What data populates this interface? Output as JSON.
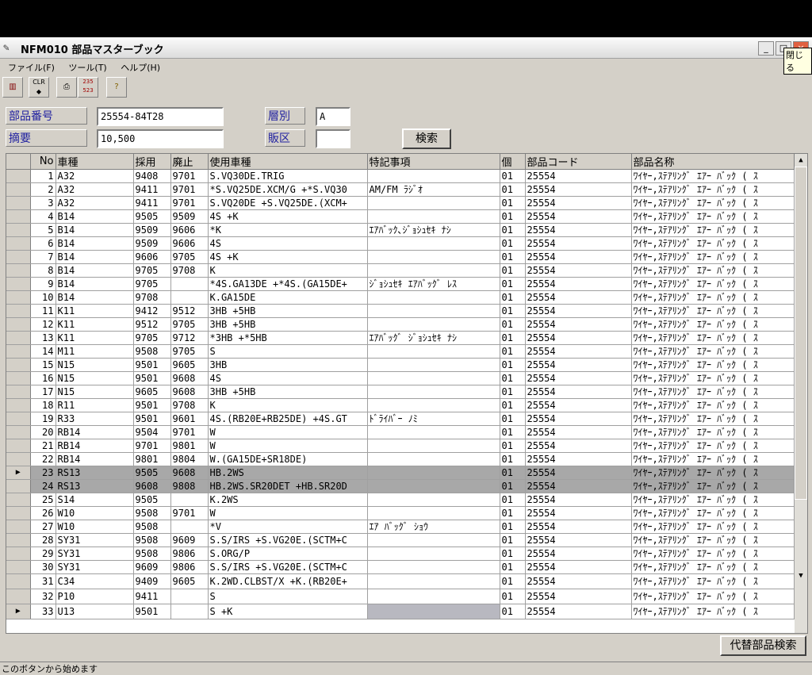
{
  "window": {
    "title": "NFM010 部品マスターブック",
    "tooltip": "閉じる",
    "min": "_",
    "max": "□",
    "close": "×"
  },
  "menu": [
    "ファイル(F)",
    "ツール(T)",
    "ヘルプ(H)"
  ],
  "toolbar": {
    "clr_label": "CLR",
    "num_label": "235 523"
  },
  "form": {
    "part_no_label": "部品番号",
    "part_no_value": "25554-84T28",
    "summary_label": "摘要",
    "summary_value": "10,500",
    "layer_label": "層別",
    "layer_value": "A",
    "sales_label": "販区",
    "sales_value": "",
    "search_button": "検索"
  },
  "table": {
    "headers": [
      "No",
      "車種",
      "採用",
      "廃止",
      "使用車種",
      "特記事項",
      "個",
      "部品コード",
      "部品名称"
    ],
    "rows": [
      [
        "1",
        "A32",
        "9408",
        "9701",
        "S.VQ30DE.TRIG",
        "",
        "01",
        "25554",
        "ﾜｲﾔｰ,ｽﾃｱﾘﾝｸﾞ ｴｱｰ ﾊﾞｯｸ ( ｽ"
      ],
      [
        "2",
        "A32",
        "9411",
        "9701",
        "*S.VQ25DE.XCM/G +*S.VQ30",
        "AM/FM ﾗｼﾞｵ",
        "01",
        "25554",
        "ﾜｲﾔｰ,ｽﾃｱﾘﾝｸﾞ ｴｱｰ ﾊﾞｯｸ ( ｽ"
      ],
      [
        "3",
        "A32",
        "9411",
        "9701",
        "S.VQ20DE +S.VQ25DE.(XCM+",
        "",
        "01",
        "25554",
        "ﾜｲﾔｰ,ｽﾃｱﾘﾝｸﾞ ｴｱｰ ﾊﾞｯｸ ( ｽ"
      ],
      [
        "4",
        "B14",
        "9505",
        "9509",
        "4S +K",
        "",
        "01",
        "25554",
        "ﾜｲﾔｰ,ｽﾃｱﾘﾝｸﾞ ｴｱｰ ﾊﾞｯｸ ( ｽ"
      ],
      [
        "5",
        "B14",
        "9509",
        "9606",
        "*K",
        "ｴｱﾊﾞｯｸ､ｼﾞｮｼｭｾｷ ﾅｼ",
        "01",
        "25554",
        "ﾜｲﾔｰ,ｽﾃｱﾘﾝｸﾞ ｴｱｰ ﾊﾞｯｸ ( ｽ"
      ],
      [
        "6",
        "B14",
        "9509",
        "9606",
        "4S",
        "",
        "01",
        "25554",
        "ﾜｲﾔｰ,ｽﾃｱﾘﾝｸﾞ ｴｱｰ ﾊﾞｯｸ ( ｽ"
      ],
      [
        "7",
        "B14",
        "9606",
        "9705",
        "4S +K",
        "",
        "01",
        "25554",
        "ﾜｲﾔｰ,ｽﾃｱﾘﾝｸﾞ ｴｱｰ ﾊﾞｯｸ ( ｽ"
      ],
      [
        "8",
        "B14",
        "9705",
        "9708",
        "K",
        "",
        "01",
        "25554",
        "ﾜｲﾔｰ,ｽﾃｱﾘﾝｸﾞ ｴｱｰ ﾊﾞｯｸ ( ｽ"
      ],
      [
        "9",
        "B14",
        "9705",
        "",
        "*4S.GA13DE +*4S.(GA15DE+",
        "ｼﾞｮｼｭｾｷ ｴｱﾊﾞｯｸﾞ ﾚｽ",
        "01",
        "25554",
        "ﾜｲﾔｰ,ｽﾃｱﾘﾝｸﾞ ｴｱｰ ﾊﾞｯｸ ( ｽ"
      ],
      [
        "10",
        "B14",
        "9708",
        "",
        "K.GA15DE",
        "",
        "01",
        "25554",
        "ﾜｲﾔｰ,ｽﾃｱﾘﾝｸﾞ ｴｱｰ ﾊﾞｯｸ ( ｽ"
      ],
      [
        "11",
        "K11",
        "9412",
        "9512",
        "3HB +5HB",
        "",
        "01",
        "25554",
        "ﾜｲﾔｰ,ｽﾃｱﾘﾝｸﾞ ｴｱｰ ﾊﾞｯｸ ( ｽ"
      ],
      [
        "12",
        "K11",
        "9512",
        "9705",
        "3HB +5HB",
        "",
        "01",
        "25554",
        "ﾜｲﾔｰ,ｽﾃｱﾘﾝｸﾞ ｴｱｰ ﾊﾞｯｸ ( ｽ"
      ],
      [
        "13",
        "K11",
        "9705",
        "9712",
        "*3HB +*5HB",
        "ｴｱﾊﾞｯｸﾞ ｼﾞｮｼｭｾｷ ﾅｼ",
        "01",
        "25554",
        "ﾜｲﾔｰ,ｽﾃｱﾘﾝｸﾞ ｴｱｰ ﾊﾞｯｸ ( ｽ"
      ],
      [
        "14",
        "M11",
        "9508",
        "9705",
        "S",
        "",
        "01",
        "25554",
        "ﾜｲﾔｰ,ｽﾃｱﾘﾝｸﾞ ｴｱｰ ﾊﾞｯｸ ( ｽ"
      ],
      [
        "15",
        "N15",
        "9501",
        "9605",
        "3HB",
        "",
        "01",
        "25554",
        "ﾜｲﾔｰ,ｽﾃｱﾘﾝｸﾞ ｴｱｰ ﾊﾞｯｸ ( ｽ"
      ],
      [
        "16",
        "N15",
        "9501",
        "9608",
        "4S",
        "",
        "01",
        "25554",
        "ﾜｲﾔｰ,ｽﾃｱﾘﾝｸﾞ ｴｱｰ ﾊﾞｯｸ ( ｽ"
      ],
      [
        "17",
        "N15",
        "9605",
        "9608",
        "3HB +5HB",
        "",
        "01",
        "25554",
        "ﾜｲﾔｰ,ｽﾃｱﾘﾝｸﾞ ｴｱｰ ﾊﾞｯｸ ( ｽ"
      ],
      [
        "18",
        "R11",
        "9501",
        "9708",
        "K",
        "",
        "01",
        "25554",
        "ﾜｲﾔｰ,ｽﾃｱﾘﾝｸﾞ ｴｱｰ ﾊﾞｯｸ ( ｽ"
      ],
      [
        "19",
        "R33",
        "9501",
        "9601",
        "4S.(RB20E+RB25DE) +4S.GT",
        "ﾄﾞﾗｲﾊﾞｰ ﾉﾐ",
        "01",
        "25554",
        "ﾜｲﾔｰ,ｽﾃｱﾘﾝｸﾞ ｴｱｰ ﾊﾞｯｸ ( ｽ"
      ],
      [
        "20",
        "RB14",
        "9504",
        "9701",
        "W",
        "",
        "01",
        "25554",
        "ﾜｲﾔｰ,ｽﾃｱﾘﾝｸﾞ ｴｱｰ ﾊﾞｯｸ ( ｽ"
      ],
      [
        "21",
        "RB14",
        "9701",
        "9801",
        "W",
        "",
        "01",
        "25554",
        "ﾜｲﾔｰ,ｽﾃｱﾘﾝｸﾞ ｴｱｰ ﾊﾞｯｸ ( ｽ"
      ],
      [
        "22",
        "RB14",
        "9801",
        "9804",
        "W.(GA15DE+SR18DE)",
        "",
        "01",
        "25554",
        "ﾜｲﾔｰ,ｽﾃｱﾘﾝｸﾞ ｴｱｰ ﾊﾞｯｸ ( ｽ"
      ],
      [
        "23",
        "RS13",
        "9505",
        "9608",
        "HB.2WS",
        "",
        "01",
        "25554",
        "ﾜｲﾔｰ,ｽﾃｱﾘﾝｸﾞ ｴｱｰ ﾊﾞｯｸ ( ｽ"
      ],
      [
        "24",
        "RS13",
        "9608",
        "9808",
        "HB.2WS.SR20DET +HB.SR20D",
        "",
        "01",
        "25554",
        "ﾜｲﾔｰ,ｽﾃｱﾘﾝｸﾞ ｴｱｰ ﾊﾞｯｸ ( ｽ"
      ],
      [
        "25",
        "S14",
        "9505",
        "",
        "K.2WS",
        "",
        "01",
        "25554",
        "ﾜｲﾔｰ,ｽﾃｱﾘﾝｸﾞ ｴｱｰ ﾊﾞｯｸ ( ｽ"
      ],
      [
        "26",
        "W10",
        "9508",
        "9701",
        "W",
        "",
        "01",
        "25554",
        "ﾜｲﾔｰ,ｽﾃｱﾘﾝｸﾞ ｴｱｰ ﾊﾞｯｸ ( ｽ"
      ],
      [
        "27",
        "W10",
        "9508",
        "",
        "*V",
        "ｴｱ ﾊﾞｯｸﾞ ｼｮｳ",
        "01",
        "25554",
        "ﾜｲﾔｰ,ｽﾃｱﾘﾝｸﾞ ｴｱｰ ﾊﾞｯｸ ( ｽ"
      ],
      [
        "28",
        "SY31",
        "9508",
        "9609",
        "S.S/IRS +S.VG20E.(SCTM+C",
        "",
        "01",
        "25554",
        "ﾜｲﾔｰ,ｽﾃｱﾘﾝｸﾞ ｴｱｰ ﾊﾞｯｸ ( ｽ"
      ],
      [
        "29",
        "SY31",
        "9508",
        "9806",
        "S.ORG/P",
        "",
        "01",
        "25554",
        "ﾜｲﾔｰ,ｽﾃｱﾘﾝｸﾞ ｴｱｰ ﾊﾞｯｸ ( ｽ"
      ],
      [
        "30",
        "SY31",
        "9609",
        "9806",
        "S.S/IRS +S.VG20E.(SCTM+C",
        "",
        "01",
        "25554",
        "ﾜｲﾔｰ,ｽﾃｱﾘﾝｸﾞ ｴｱｰ ﾊﾞｯｸ ( ｽ"
      ],
      [
        "31",
        "C34",
        "9409",
        "9605",
        "K.2WD.CLBST/X +K.(RB20E+",
        "",
        "01",
        "25554",
        "ﾜｲﾔｰ,ｽﾃｱﾘﾝｸﾞ ｴｱｰ ﾊﾞｯｸ ( ｽ"
      ],
      [
        "32",
        "P10",
        "9411",
        "",
        "S",
        "",
        "01",
        "25554",
        "ﾜｲﾔｰ,ｽﾃｱﾘﾝｸﾞ ｴｱｰ ﾊﾞｯｸ ( ｽ"
      ],
      [
        "33",
        "U13",
        "9501",
        "",
        "S +K",
        "",
        "01",
        "25554",
        "ﾜｲﾔｰ,ｽﾃｱﾘﾝｸﾞ ｴｱｰ ﾊﾞｯｸ ( ｽ"
      ]
    ],
    "highlighted_rows": [
      "23",
      "24"
    ],
    "current_row_markers": [
      "23",
      "33"
    ]
  },
  "alt_search_button": "代替部品検索",
  "status": "このボタンから始めます"
}
